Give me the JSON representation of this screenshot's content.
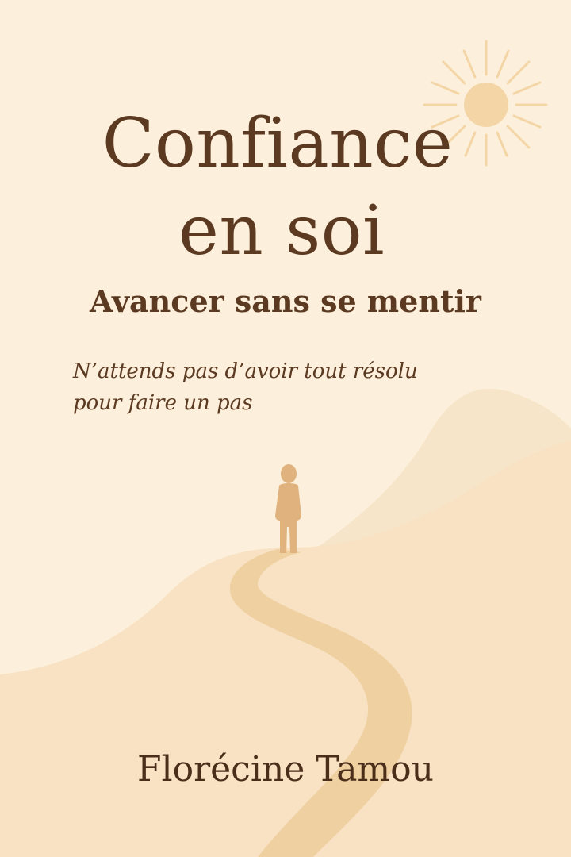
{
  "cover": {
    "title_line_1": "Confiance",
    "title_line_2": "en soi",
    "subtitle": "Avancer sans se mentir",
    "tagline_line_1": "N’attends pas d’avoir tout résolu",
    "tagline_line_2": "pour faire un pas",
    "author": "Florécine Tamou"
  },
  "illustration": {
    "icons": [
      "sun-icon",
      "walking-person-icon"
    ],
    "colors": {
      "background": "#fcf0dc",
      "text": "#5c3a22",
      "sun": "#f1d3a4",
      "hill_far": "#f6e4c8",
      "hill_near": "#f8e2c4",
      "path": "#efd0a0",
      "person": "#e0b27c"
    }
  }
}
